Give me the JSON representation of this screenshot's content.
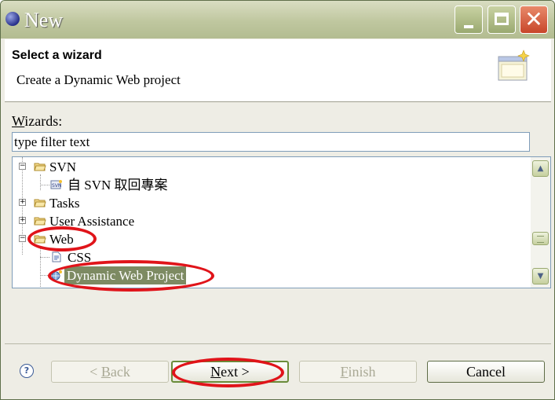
{
  "window": {
    "title": "New"
  },
  "header": {
    "title": "Select a wizard",
    "description": "Create a Dynamic Web project"
  },
  "wizards": {
    "label_prefix": "",
    "label_accel": "W",
    "label_rest": "izards:",
    "filter_value": "type filter text"
  },
  "tree": {
    "items": [
      {
        "label": "SVN",
        "expanded": true
      },
      {
        "label": "自 SVN 取回專案"
      },
      {
        "label": "Tasks",
        "expanded": false
      },
      {
        "label": "User Assistance",
        "expanded": false
      },
      {
        "label": "Web",
        "expanded": true
      },
      {
        "label": "CSS"
      },
      {
        "label": "Dynamic Web Project",
        "selected": true
      }
    ]
  },
  "buttons": {
    "back": {
      "prefix": "< ",
      "accel": "B",
      "rest": "ack"
    },
    "next": {
      "accel": "N",
      "rest": "ext >"
    },
    "finish": {
      "accel": "F",
      "rest": "inish"
    },
    "cancel": "Cancel"
  },
  "colors": {
    "selection": "#7d8a62",
    "annotation": "#e0141a",
    "titlebar": "#bfc79f"
  }
}
